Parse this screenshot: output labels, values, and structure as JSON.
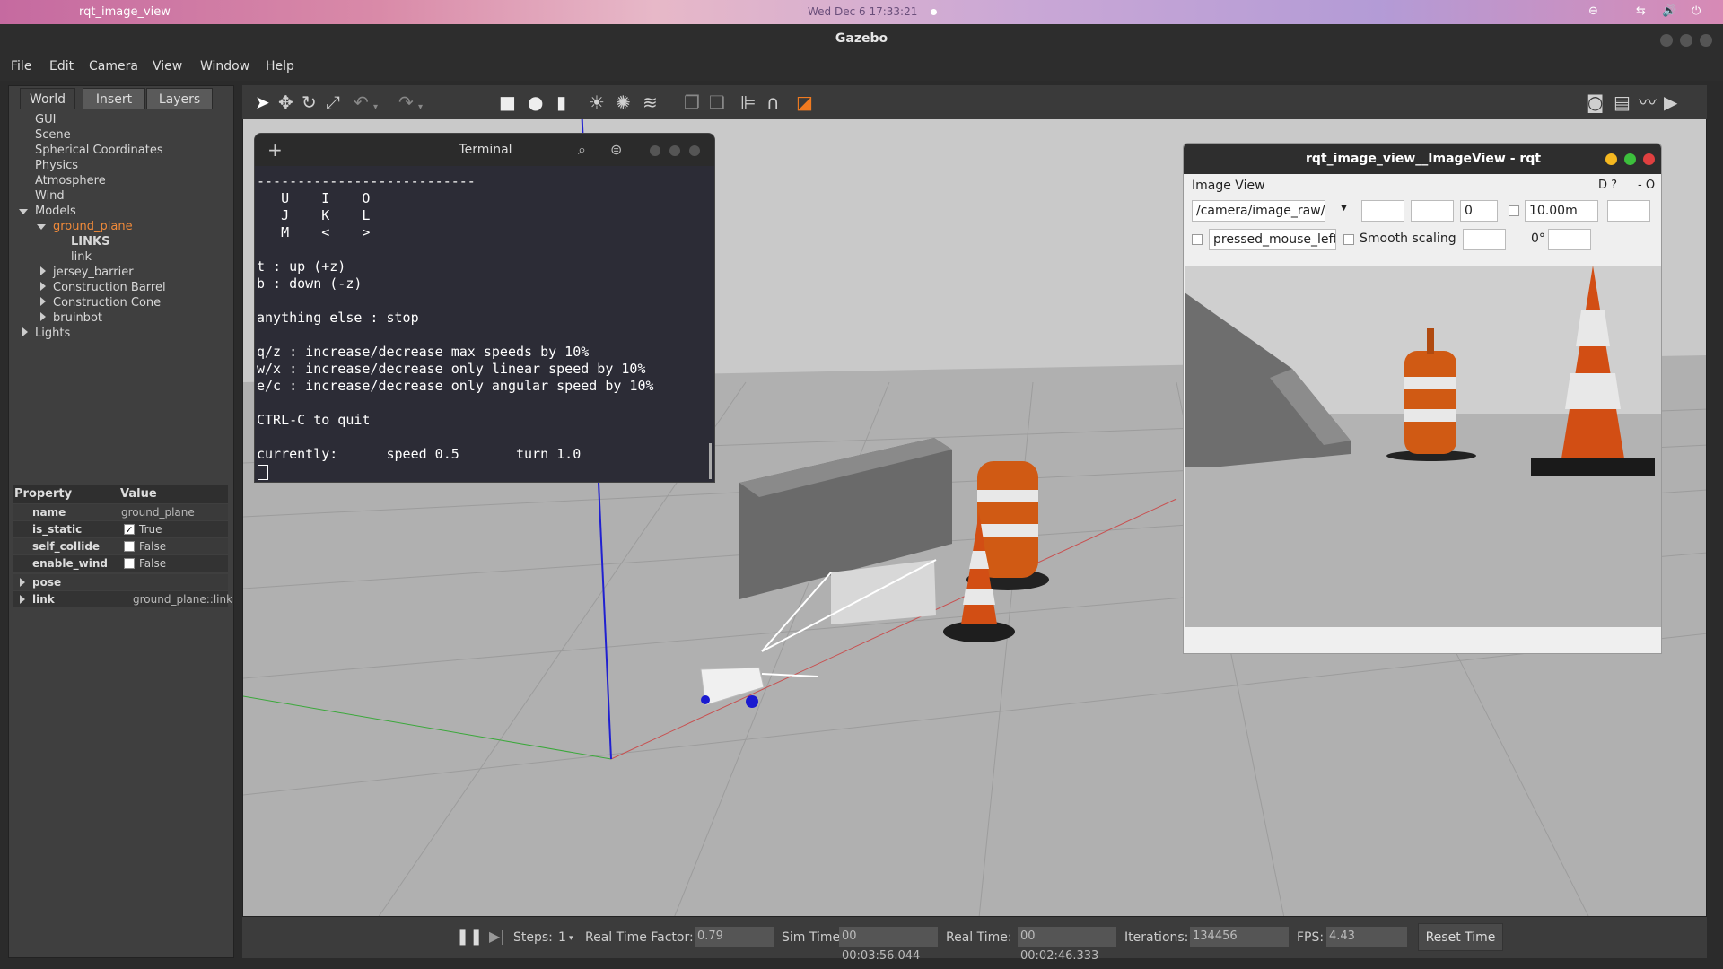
{
  "topbar": {
    "app_title": "rqt_image_view",
    "clock": "Wed Dec 6  17:33:21"
  },
  "window": {
    "title": "Gazebo"
  },
  "menu": {
    "file": "File",
    "edit": "Edit",
    "camera": "Camera",
    "view": "View",
    "window": "Window",
    "help": "Help"
  },
  "tabs": {
    "world": "World",
    "insert": "Insert",
    "layers": "Layers"
  },
  "tree": {
    "gui": "GUI",
    "scene": "Scene",
    "spherical": "Spherical Coordinates",
    "physics": "Physics",
    "atmosphere": "Atmosphere",
    "wind": "Wind",
    "models": "Models",
    "ground_plane": "ground_plane",
    "links_hdr": "LINKS",
    "link": "link",
    "jersey": "jersey_barrier",
    "barrel": "Construction Barrel",
    "cone": "Construction Cone",
    "bruinbot": "bruinbot",
    "lights": "Lights"
  },
  "props": {
    "hdr_property": "Property",
    "hdr_value": "Value",
    "name_k": "name",
    "name_v": "ground_plane",
    "static_k": "is_static",
    "static_v": "True",
    "collide_k": "self_collide",
    "collide_v": "False",
    "wind_k": "enable_wind",
    "wind_v": "False",
    "pose_k": "pose",
    "link_k": "link",
    "link_v": "ground_plane::link"
  },
  "terminal": {
    "title": "Terminal",
    "lines": "---------------------------\n   U    I    O\n   J    K    L\n   M    <    >\n\nt : up (+z)\nb : down (-z)\n\nanything else : stop\n\nq/z : increase/decrease max speeds by 10%\nw/x : increase/decrease only linear speed by 10%\ne/c : increase/decrease only angular speed by 10%\n\nCTRL-C to quit\n\ncurrently:      speed 0.5       turn 1.0"
  },
  "rqt": {
    "title": "rqt_image_view__ImageView - rqt",
    "label": "Image View",
    "corner": "D ?",
    "corner2": "- O",
    "topic": "/camera/image_raw/co",
    "spin_value": "0",
    "range": "10.00m",
    "mouse_topic": "pressed_mouse_left",
    "smooth": "Smooth scaling",
    "rotation": "0°"
  },
  "status": {
    "steps_label": "Steps:",
    "steps_value": "1",
    "rtf_label": "Real Time Factor:",
    "rtf_value": "0.79",
    "sim_label": "Sim Time:",
    "sim_value": "00 00:03:56.044",
    "real_label": "Real Time:",
    "real_value": "00 00:02:46.333",
    "iter_label": "Iterations:",
    "iter_value": "134456",
    "fps_label": "FPS:",
    "fps_value": "4.43",
    "reset": "Reset Time"
  },
  "colors": {
    "selected": "#f08a3a",
    "viewport_bg": "#c8c8c8",
    "terminal_bg": "#2c2c36"
  },
  "icons": [
    "apple-icon",
    "select-icon",
    "translate-icon",
    "rotate-icon",
    "scale-icon",
    "undo-icon",
    "redo-icon",
    "box-icon",
    "sphere-icon",
    "cylinder-icon",
    "sun-icon",
    "spot-light-icon",
    "directional-light-icon",
    "copy-icon",
    "paste-icon",
    "align-icon",
    "magnet-icon",
    "orange-box-icon",
    "camera-icon",
    "log-icon",
    "plot-icon",
    "video-icon",
    "pause-icon",
    "step-icon",
    "search-icon",
    "menu-icon"
  ]
}
